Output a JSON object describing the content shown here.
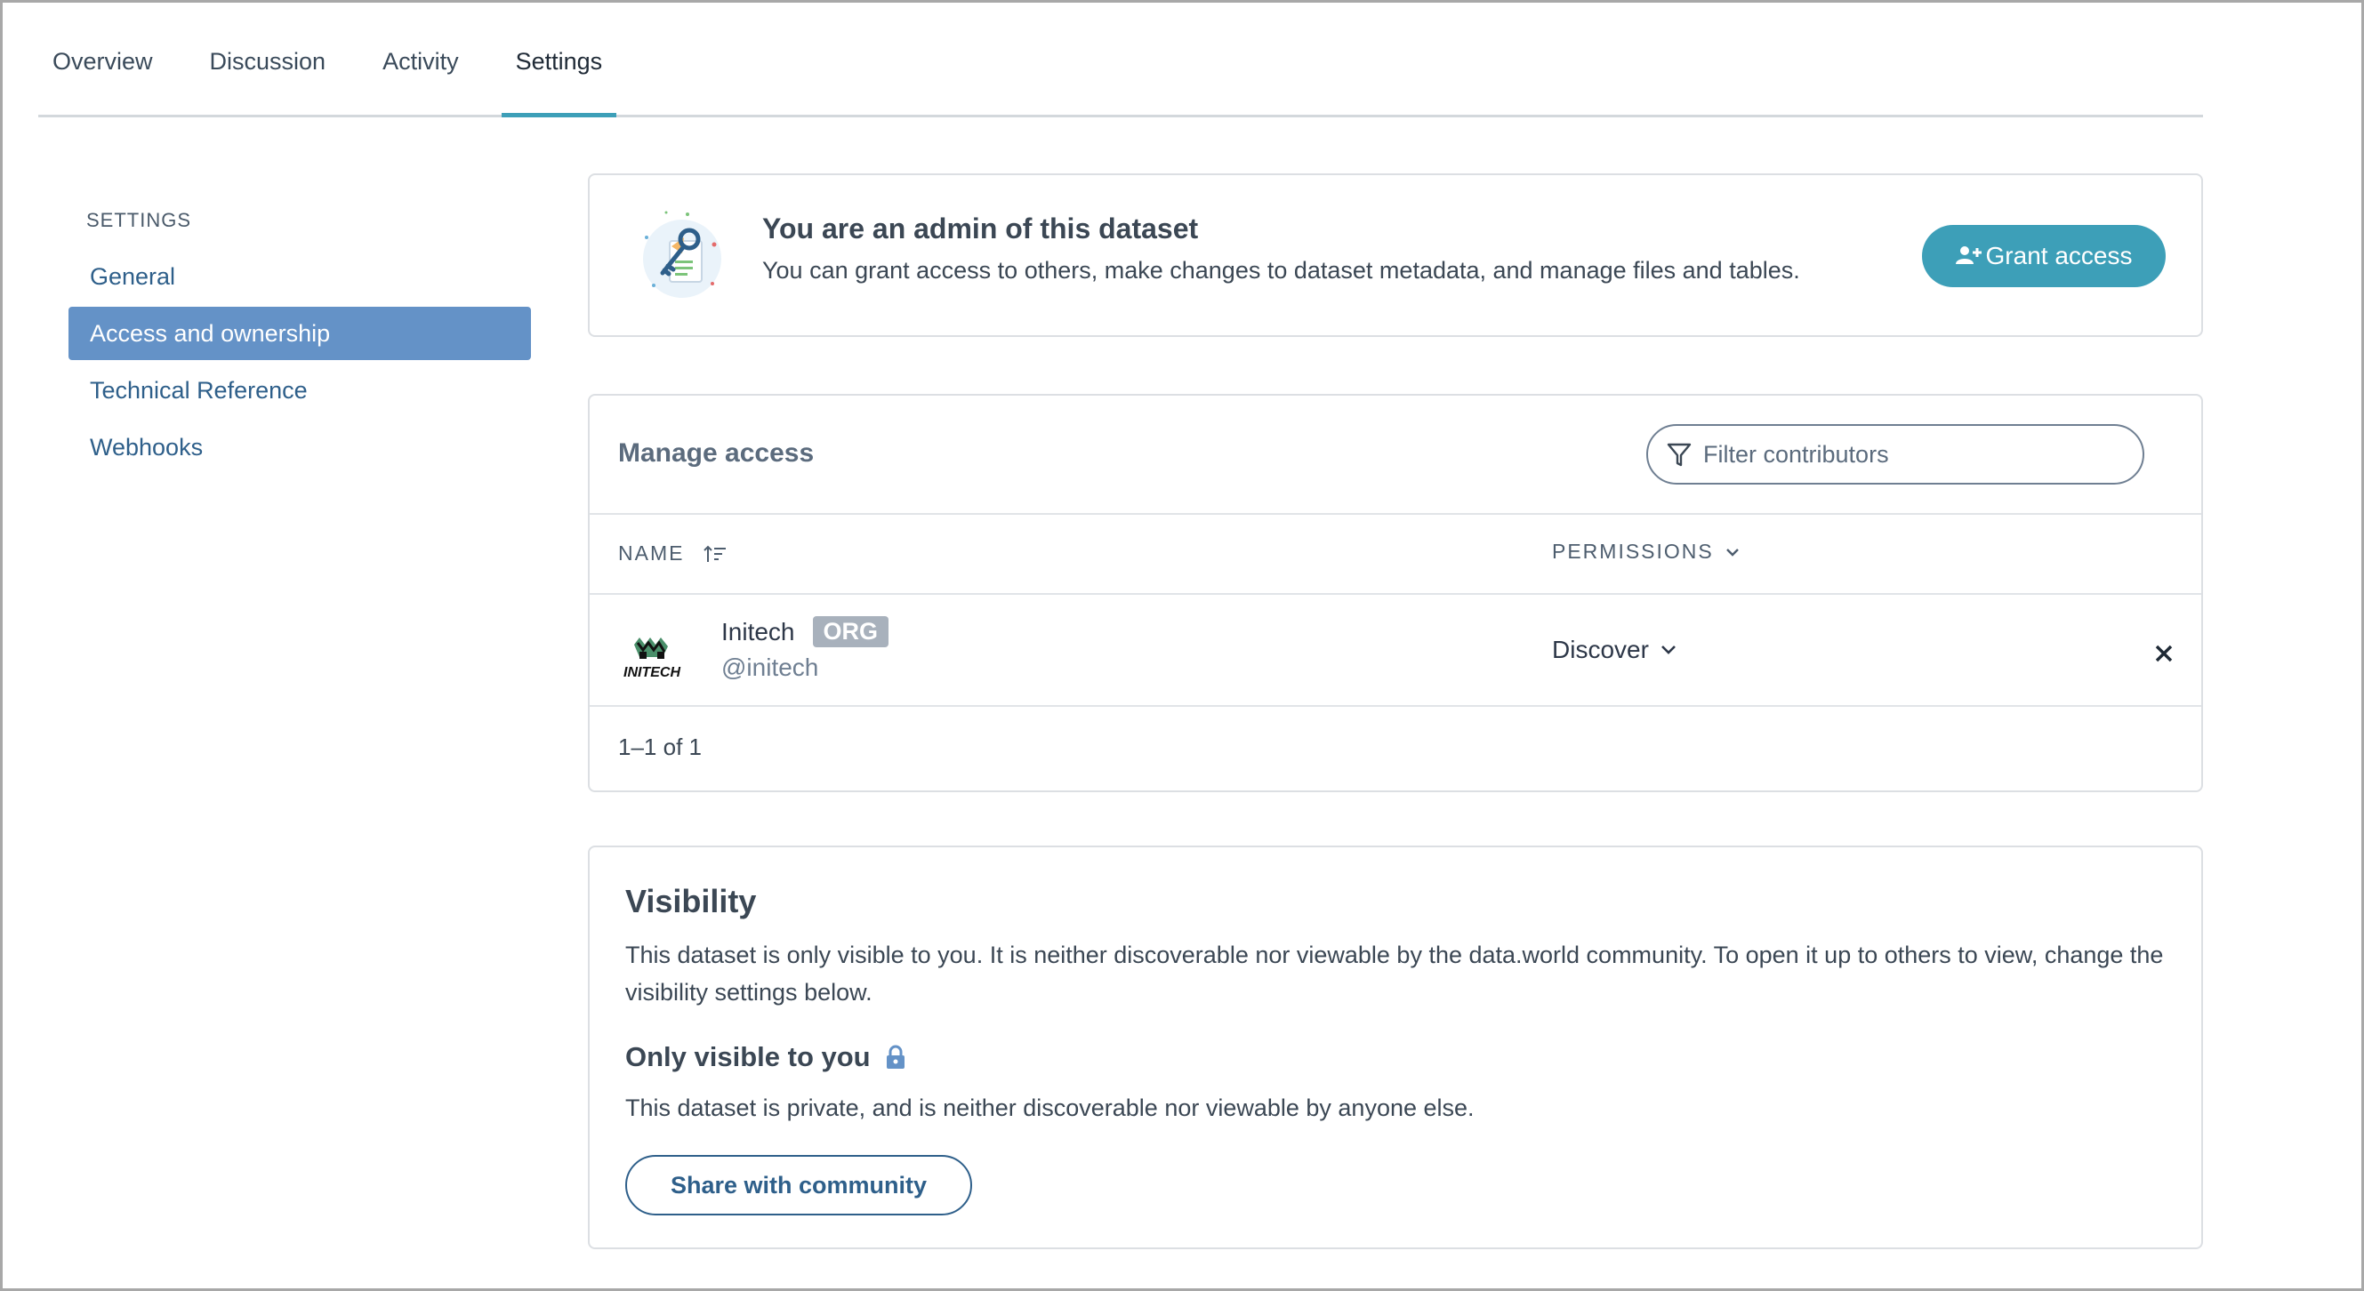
{
  "tabs": [
    {
      "label": "Overview"
    },
    {
      "label": "Discussion"
    },
    {
      "label": "Activity"
    },
    {
      "label": "Settings"
    }
  ],
  "sidebar": {
    "heading": "SETTINGS",
    "items": [
      {
        "label": "General"
      },
      {
        "label": "Access and ownership"
      },
      {
        "label": "Technical Reference"
      },
      {
        "label": "Webhooks"
      }
    ],
    "active_item": "Access and ownership"
  },
  "admin_notice": {
    "title": "You are an admin of this dataset",
    "description": "You can grant access to others, make changes to dataset metadata, and manage files and tables.",
    "grant_button": "Grant access"
  },
  "manage_access": {
    "title": "Manage access",
    "filter_placeholder": "Filter contributors",
    "columns": {
      "name": "NAME",
      "permissions": "PERMISSIONS"
    },
    "rows": [
      {
        "name": "Initech",
        "badge": "ORG",
        "handle": "@initech",
        "permission": "Discover",
        "logo_text": "INITECH"
      }
    ],
    "pagination": "1–1 of 1"
  },
  "visibility": {
    "title": "Visibility",
    "description": "This dataset is only visible to you. It is neither discoverable nor viewable by the data.world community. To open it up to others to view, change the visibility settings below.",
    "status_title": "Only visible to you",
    "status_note": "This dataset is private, and is neither discoverable nor viewable by anyone else.",
    "share_button": "Share with community"
  },
  "colors": {
    "accent": "#3d9fb8",
    "sidebar_active": "#6492c7",
    "link": "#2e5f8a"
  }
}
